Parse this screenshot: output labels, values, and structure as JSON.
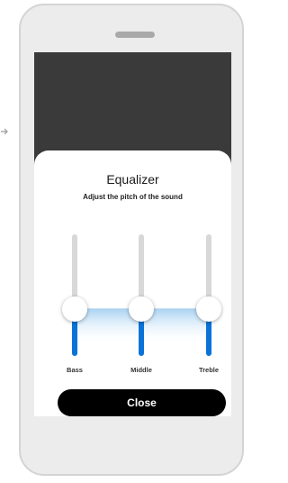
{
  "back_arrow_icon": "arrow-right-icon",
  "equalizer": {
    "title": "Equalizer",
    "subtitle": "Adjust the pitch of the sound",
    "bands": [
      {
        "label": "Bass",
        "level": 0.5
      },
      {
        "label": "Middle",
        "level": 0.5
      },
      {
        "label": "Treble",
        "level": 0.5
      }
    ],
    "close_label": "Close"
  },
  "colors": {
    "accent": "#0a73d8",
    "fill_gradient": "#a8d2f2",
    "button": "#000000",
    "backdrop": "#3a3a3a"
  }
}
